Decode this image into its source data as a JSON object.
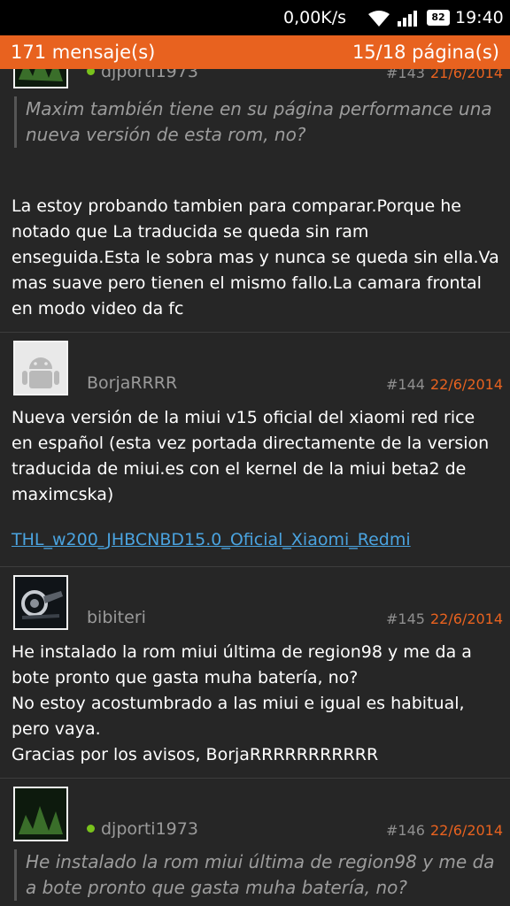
{
  "status_bar": {
    "network_speed": "0,00K/s",
    "battery_level": "82",
    "time": "19:40"
  },
  "thread_header": {
    "message_count": "171 mensaje(s)",
    "page_indicator": "15/18 página(s)"
  },
  "posts": [
    {
      "author": "djporti1973",
      "number": "#143",
      "date": "21/6/2014",
      "quote": "Maxim también tiene en su página performance una nueva versión de esta rom, no?",
      "body": "La estoy probando tambien para comparar.Porque he notado que La traducida se queda sin ram enseguida.Esta le sobra mas y nunca se queda sin ella.Va mas suave pero tienen el mismo fallo.La camara frontal en modo video da fc"
    },
    {
      "author": "BorjaRRRR",
      "number": "#144",
      "date": "22/6/2014",
      "body": "Nueva versión de la miui v15 oficial del xiaomi red rice en español (esta vez portada directamente de la version traducida de miui.es con el kernel de la miui beta2 de maximcska)",
      "link": "THL_w200_JHBCNBD15.0_Oficial_Xiaomi_Redmi"
    },
    {
      "author": "bibiteri",
      "number": "#145",
      "date": "22/6/2014",
      "body": "He instalado la rom miui última de region98 y me da a bote pronto que gasta muha batería, no?\nNo estoy acostumbrado a las miui e igual es habitual, pero vaya.\nGracias por los avisos, BorjaRRRRRRRRRRR"
    },
    {
      "author": "djporti1973",
      "number": "#146",
      "date": "22/6/2014",
      "quote": "He instalado la rom miui última de region98 y me da a bote pronto que gasta muha batería, no?"
    }
  ],
  "colors": {
    "accent": "#e8621f",
    "background": "#262626",
    "online": "#79c21c",
    "link": "#4aa3df"
  }
}
